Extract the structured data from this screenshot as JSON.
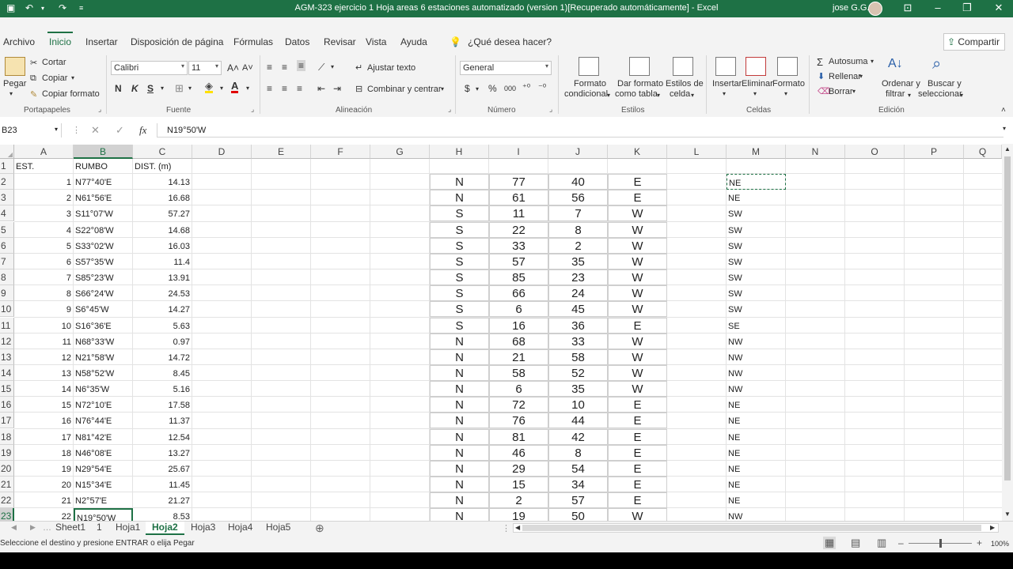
{
  "window": {
    "title": "AGM-323 ejercicio 1 Hoja areas 6 estaciones automatizado (version 1)[Recuperado automáticamente]  -  Excel",
    "user": "jose G.G."
  },
  "menu": {
    "tabs": [
      "Archivo",
      "Inicio",
      "Insertar",
      "Disposición de página",
      "Fórmulas",
      "Datos",
      "Revisar",
      "Vista",
      "Ayuda"
    ],
    "tell_me": "¿Qué desea hacer?",
    "share": "Compartir"
  },
  "ribbon": {
    "clipboard": {
      "paste": "Pegar",
      "cut": "Cortar",
      "copy": "Copiar",
      "format_painter": "Copiar formato",
      "group": "Portapapeles"
    },
    "font": {
      "name": "Calibri",
      "size": "11",
      "bold": "N",
      "italic": "K",
      "underline": "S",
      "group": "Fuente"
    },
    "alignment": {
      "wrap": "Ajustar texto",
      "merge": "Combinar y centrar",
      "group": "Alineación"
    },
    "number": {
      "format": "General",
      "currency": "$",
      "percent": "%",
      "thousands": "000",
      "group": "Número"
    },
    "styles": {
      "conditional": [
        "Formato",
        "condicional"
      ],
      "as_table": [
        "Dar formato",
        "como tabla"
      ],
      "cell_styles": [
        "Estilos de",
        "celda"
      ],
      "group": "Estilos"
    },
    "cells": {
      "insert": "Insertar",
      "delete": "Eliminar",
      "format": "Formato",
      "group": "Celdas"
    },
    "editing": {
      "autosum": "Autosuma",
      "fill": "Rellenar",
      "clear": "Borrar",
      "sort": [
        "Ordenar y",
        "filtrar"
      ],
      "find": [
        "Buscar y",
        "seleccionar"
      ],
      "group": "Edición"
    }
  },
  "formula_bar": {
    "name_box": "B23",
    "fx": "fx",
    "content": "N19°50'W"
  },
  "columns": [
    "A",
    "B",
    "C",
    "D",
    "E",
    "F",
    "G",
    "H",
    "I",
    "J",
    "K",
    "L",
    "M",
    "N",
    "O",
    "P",
    "Q"
  ],
  "rows": [
    "1",
    "2",
    "3",
    "4",
    "5",
    "6",
    "7",
    "8",
    "9",
    "10",
    "11",
    "12",
    "13",
    "14",
    "15",
    "16",
    "17",
    "18",
    "19",
    "20",
    "21",
    "22",
    "23"
  ],
  "header_row": {
    "a": "EST.",
    "b": "RUMBO",
    "c": "DIST. (m)"
  },
  "data": [
    {
      "est": "1",
      "rumbo": "N77°40'E",
      "dist": "14.13",
      "h": "N",
      "i": "77",
      "j": "40",
      "k": "E",
      "m": "NE"
    },
    {
      "est": "2",
      "rumbo": "N61°56'E",
      "dist": "16.68",
      "h": "N",
      "i": "61",
      "j": "56",
      "k": "E",
      "m": "NE"
    },
    {
      "est": "3",
      "rumbo": "S11°07'W",
      "dist": "57.27",
      "h": "S",
      "i": "11",
      "j": "7",
      "k": "W",
      "m": "SW"
    },
    {
      "est": "4",
      "rumbo": "S22°08'W",
      "dist": "14.68",
      "h": "S",
      "i": "22",
      "j": "8",
      "k": "W",
      "m": "SW"
    },
    {
      "est": "5",
      "rumbo": "S33°02'W",
      "dist": "16.03",
      "h": "S",
      "i": "33",
      "j": "2",
      "k": "W",
      "m": "SW"
    },
    {
      "est": "6",
      "rumbo": "S57°35'W",
      "dist": "11.4",
      "h": "S",
      "i": "57",
      "j": "35",
      "k": "W",
      "m": "SW"
    },
    {
      "est": "7",
      "rumbo": "S85°23'W",
      "dist": "13.91",
      "h": "S",
      "i": "85",
      "j": "23",
      "k": "W",
      "m": "SW"
    },
    {
      "est": "8",
      "rumbo": "S66°24'W",
      "dist": "24.53",
      "h": "S",
      "i": "66",
      "j": "24",
      "k": "W",
      "m": "SW"
    },
    {
      "est": "9",
      "rumbo": "S6°45'W",
      "dist": "14.27",
      "h": "S",
      "i": "6",
      "j": "45",
      "k": "W",
      "m": "SW"
    },
    {
      "est": "10",
      "rumbo": "S16°36'E",
      "dist": "5.63",
      "h": "S",
      "i": "16",
      "j": "36",
      "k": "E",
      "m": "SE"
    },
    {
      "est": "11",
      "rumbo": "N68°33'W",
      "dist": "0.97",
      "h": "N",
      "i": "68",
      "j": "33",
      "k": "W",
      "m": "NW"
    },
    {
      "est": "12",
      "rumbo": "N21°58'W",
      "dist": "14.72",
      "h": "N",
      "i": "21",
      "j": "58",
      "k": "W",
      "m": "NW"
    },
    {
      "est": "13",
      "rumbo": "N58°52'W",
      "dist": "8.45",
      "h": "N",
      "i": "58",
      "j": "52",
      "k": "W",
      "m": "NW"
    },
    {
      "est": "14",
      "rumbo": "N6°35'W",
      "dist": "5.16",
      "h": "N",
      "i": "6",
      "j": "35",
      "k": "W",
      "m": "NW"
    },
    {
      "est": "15",
      "rumbo": "N72°10'E",
      "dist": "17.58",
      "h": "N",
      "i": "72",
      "j": "10",
      "k": "E",
      "m": "NE"
    },
    {
      "est": "16",
      "rumbo": "N76°44'E",
      "dist": "11.37",
      "h": "N",
      "i": "76",
      "j": "44",
      "k": "E",
      "m": "NE"
    },
    {
      "est": "17",
      "rumbo": "N81°42'E",
      "dist": "12.54",
      "h": "N",
      "i": "81",
      "j": "42",
      "k": "E",
      "m": "NE"
    },
    {
      "est": "18",
      "rumbo": "N46°08'E",
      "dist": "13.27",
      "h": "N",
      "i": "46",
      "j": "8",
      "k": "E",
      "m": "NE"
    },
    {
      "est": "19",
      "rumbo": "N29°54'E",
      "dist": "25.67",
      "h": "N",
      "i": "29",
      "j": "54",
      "k": "E",
      "m": "NE"
    },
    {
      "est": "20",
      "rumbo": "N15°34'E",
      "dist": "11.45",
      "h": "N",
      "i": "15",
      "j": "34",
      "k": "E",
      "m": "NE"
    },
    {
      "est": "21",
      "rumbo": "N2°57'E",
      "dist": "21.27",
      "h": "N",
      "i": "2",
      "j": "57",
      "k": "E",
      "m": "NE"
    },
    {
      "est": "22",
      "rumbo": "N19°50'W",
      "dist": "8.53",
      "h": "N",
      "i": "19",
      "j": "50",
      "k": "W",
      "m": "NW"
    }
  ],
  "sheets": [
    "Sheet1",
    "1",
    "Hoja1",
    "Hoja2",
    "Hoja3",
    "Hoja4",
    "Hoja5"
  ],
  "active_sheet": "Hoja2",
  "status": {
    "message": "Seleccione el destino y presione ENTRAR o elija Pegar",
    "zoom": "100%"
  },
  "colors": {
    "accent": "#1e7145",
    "ribbon_bg": "#f3f3f3"
  }
}
